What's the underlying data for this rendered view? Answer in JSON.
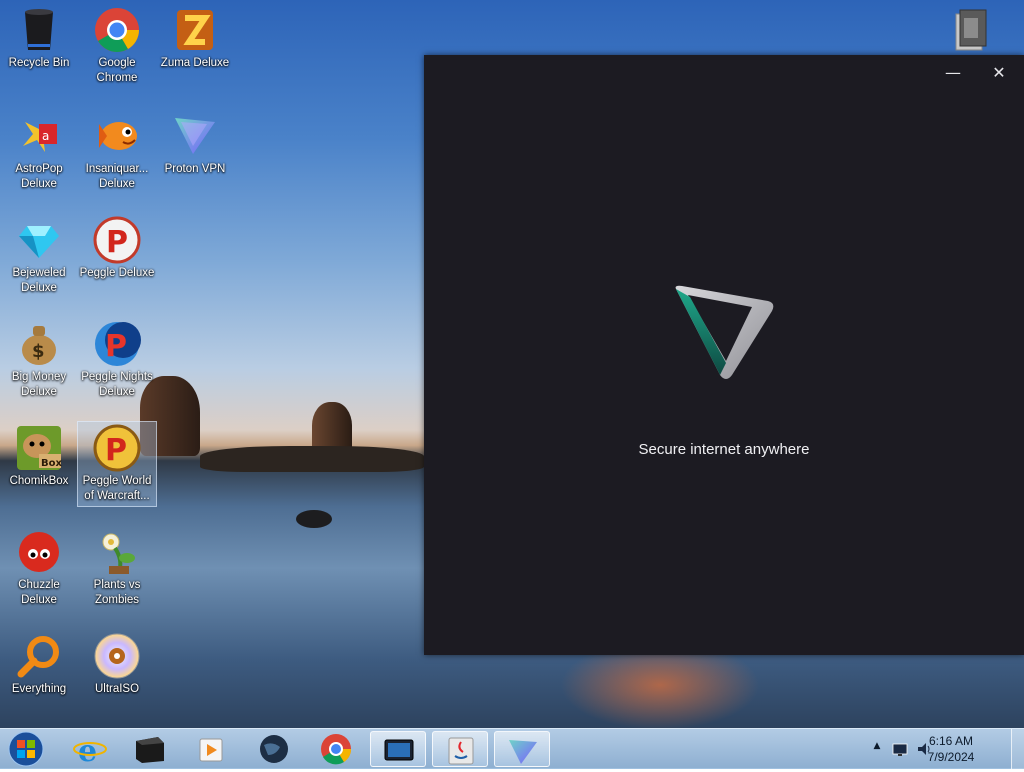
{
  "desktop": {
    "icons": [
      {
        "label": "Recycle Bin",
        "icon": "recycle-bin-icon"
      },
      {
        "label": "Google Chrome",
        "icon": "chrome-icon"
      },
      {
        "label": "Zuma Deluxe",
        "icon": "zuma-icon"
      },
      {
        "label": "AstroPop Deluxe",
        "icon": "astropop-icon"
      },
      {
        "label": "Insaniquar... Deluxe",
        "icon": "insaniquarium-icon"
      },
      {
        "label": "Proton VPN",
        "icon": "protonvpn-icon"
      },
      {
        "label": "Bejeweled Deluxe",
        "icon": "bejeweled-icon"
      },
      {
        "label": "Peggle Deluxe",
        "icon": "peggle-icon"
      },
      {
        "label": "Big Money Deluxe",
        "icon": "big-money-icon"
      },
      {
        "label": "Peggle Nights Deluxe",
        "icon": "peggle-nights-icon"
      },
      {
        "label": "ChomikBox",
        "icon": "chomikbox-icon"
      },
      {
        "label": "Peggle World of Warcraft...",
        "icon": "peggle-wow-icon"
      },
      {
        "label": "Chuzzle Deluxe",
        "icon": "chuzzle-icon"
      },
      {
        "label": "Plants vs Zombies",
        "icon": "plants-vs-zombies-icon"
      },
      {
        "label": "Everything",
        "icon": "everything-search-icon"
      },
      {
        "label": "UltraISO",
        "icon": "ultraiso-icon"
      }
    ]
  },
  "vpn_window": {
    "minimize_glyph": "—",
    "close_glyph": "✕",
    "tagline": "Secure internet anywhere"
  },
  "taskbar": {
    "clock_time": "6:16 AM",
    "clock_date": "7/9/2024",
    "tray_arrow": "▲"
  },
  "colors": {
    "window_bg": "#1c1b22",
    "proton_teal": "#1fa88a",
    "proton_purple": "#8a6cff"
  }
}
